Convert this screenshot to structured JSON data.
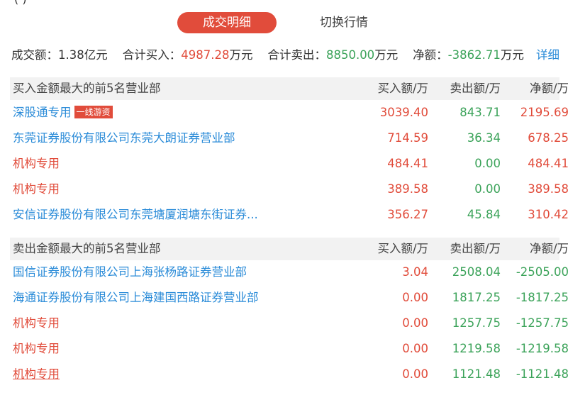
{
  "cut_header": "(    )  ·   ",
  "tabs": [
    {
      "label": "成交明细",
      "active": true
    },
    {
      "label": "切换行情",
      "active": false
    }
  ],
  "summary": {
    "turnover_label": "成交额：",
    "turnover_value": "1.38亿元",
    "buy_total_label": "合计买入：",
    "buy_total_value": "4987.28",
    "buy_total_unit": "万元",
    "sell_total_label": "合计卖出：",
    "sell_total_value": "8850.00",
    "sell_total_unit": "万元",
    "net_label": "净额：",
    "net_value": "-3862.71",
    "net_unit": "万元",
    "detail_link": "详细"
  },
  "buy_section": {
    "title": "买入金额最大的前5名营业部",
    "col_buy": "买入额/万",
    "col_sell": "卖出额/万",
    "col_net": "净额/万",
    "rows": [
      {
        "name": "深股通专用",
        "badge": "一线游资",
        "buy": "3039.40",
        "sell": "843.71",
        "net": "2195.69"
      },
      {
        "name": "东莞证券股份有限公司东莞大朗证券营业部",
        "badge": "",
        "buy": "714.59",
        "sell": "36.34",
        "net": "678.25"
      },
      {
        "name": "机构专用",
        "badge": "",
        "buy": "484.41",
        "sell": "0.00",
        "net": "484.41"
      },
      {
        "name": "机构专用",
        "badge": "",
        "buy": "389.58",
        "sell": "0.00",
        "net": "389.58"
      },
      {
        "name": "安信证券股份有限公司东莞塘厦润塘东街证券...",
        "badge": "",
        "buy": "356.27",
        "sell": "45.84",
        "net": "310.42"
      }
    ]
  },
  "sell_section": {
    "title": "卖出金额最大的前5名营业部",
    "col_buy": "买入额/万",
    "col_sell": "卖出额/万",
    "col_net": "净额/万",
    "rows": [
      {
        "name": "国信证券股份有限公司上海张杨路证券营业部",
        "buy": "3.04",
        "sell": "2508.04",
        "net": "-2505.00"
      },
      {
        "name": "海通证券股份有限公司上海建国西路证券营业部",
        "buy": "0.00",
        "sell": "1817.25",
        "net": "-1817.25"
      },
      {
        "name": "机构专用",
        "buy": "0.00",
        "sell": "1257.75",
        "net": "-1257.75"
      },
      {
        "name": "机构专用",
        "buy": "0.00",
        "sell": "1219.58",
        "net": "-1219.58"
      },
      {
        "name": "机构专用",
        "buy": "0.00",
        "sell": "1121.48",
        "net": "-1121.48"
      }
    ]
  },
  "colors": {
    "accent": "#e14c3b",
    "positive": "#e14c3b",
    "negative": "#3ca35a",
    "link": "#2a8bd8",
    "header_bg": "#f2f2f2"
  }
}
